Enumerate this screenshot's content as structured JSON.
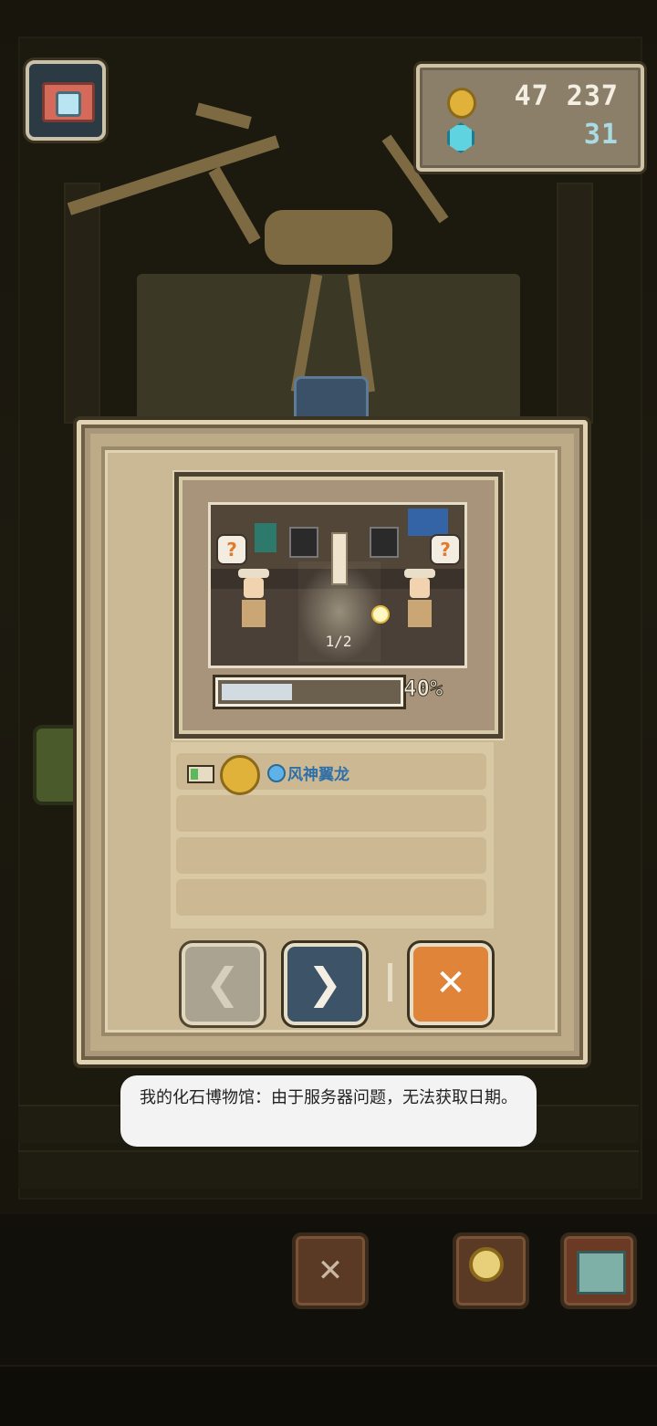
{
  "hud": {
    "photo_icon": "camera-icon",
    "coins": "47 237",
    "gems": "31",
    "coin_icon": "coin-icon",
    "gem_icon": "gem-icon"
  },
  "dialog": {
    "preview": {
      "page": "1/2"
    },
    "progress": {
      "value": 0.4,
      "label": "40%"
    },
    "rewards": [
      {
        "name": "风神翼龙"
      }
    ],
    "buttons": {
      "prev_icon": "chevron-left-icon",
      "next_icon": "chevron-right-icon",
      "close_icon": "close-icon"
    }
  },
  "toast": {
    "text": "我的化石博物馆：由于服务器问题，无法获取日期。"
  },
  "colors": {
    "panel": "#cbb995",
    "accent_orange": "#e0843a",
    "next_blue": "#3d5368",
    "reward_blue": "#2f6fa8"
  }
}
